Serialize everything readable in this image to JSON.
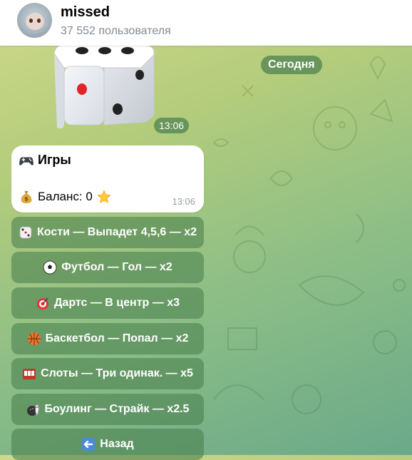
{
  "header": {
    "title": "missed",
    "subtitle": "37 552 пользователя"
  },
  "chat": {
    "date_chip": "Сегодня",
    "dice_time": "13:06",
    "message": {
      "title": "Игры",
      "balance": "Баланс: 0",
      "time": "13:06"
    },
    "keyboard": [
      {
        "label": "Кости — Выпадет 4,5,6 — x2",
        "icon": "dice-icon"
      },
      {
        "label": "Футбол — Гол — x2",
        "icon": "soccer-ball-icon"
      },
      {
        "label": "Дартс — В центр — x3",
        "icon": "dart-icon"
      },
      {
        "label": "Баскетбол — Попал — x2",
        "icon": "basketball-icon"
      },
      {
        "label": "Слоты — Три одинак. — x5",
        "icon": "slot-machine-icon"
      },
      {
        "label": "Боулинг — Страйк — x2.5",
        "icon": "bowling-icon"
      },
      {
        "label": "Назад",
        "icon": "back-arrow-icon"
      }
    ]
  },
  "colors": {
    "chip_bg": "#4a804e",
    "bubble_bg": "#ffffff"
  }
}
